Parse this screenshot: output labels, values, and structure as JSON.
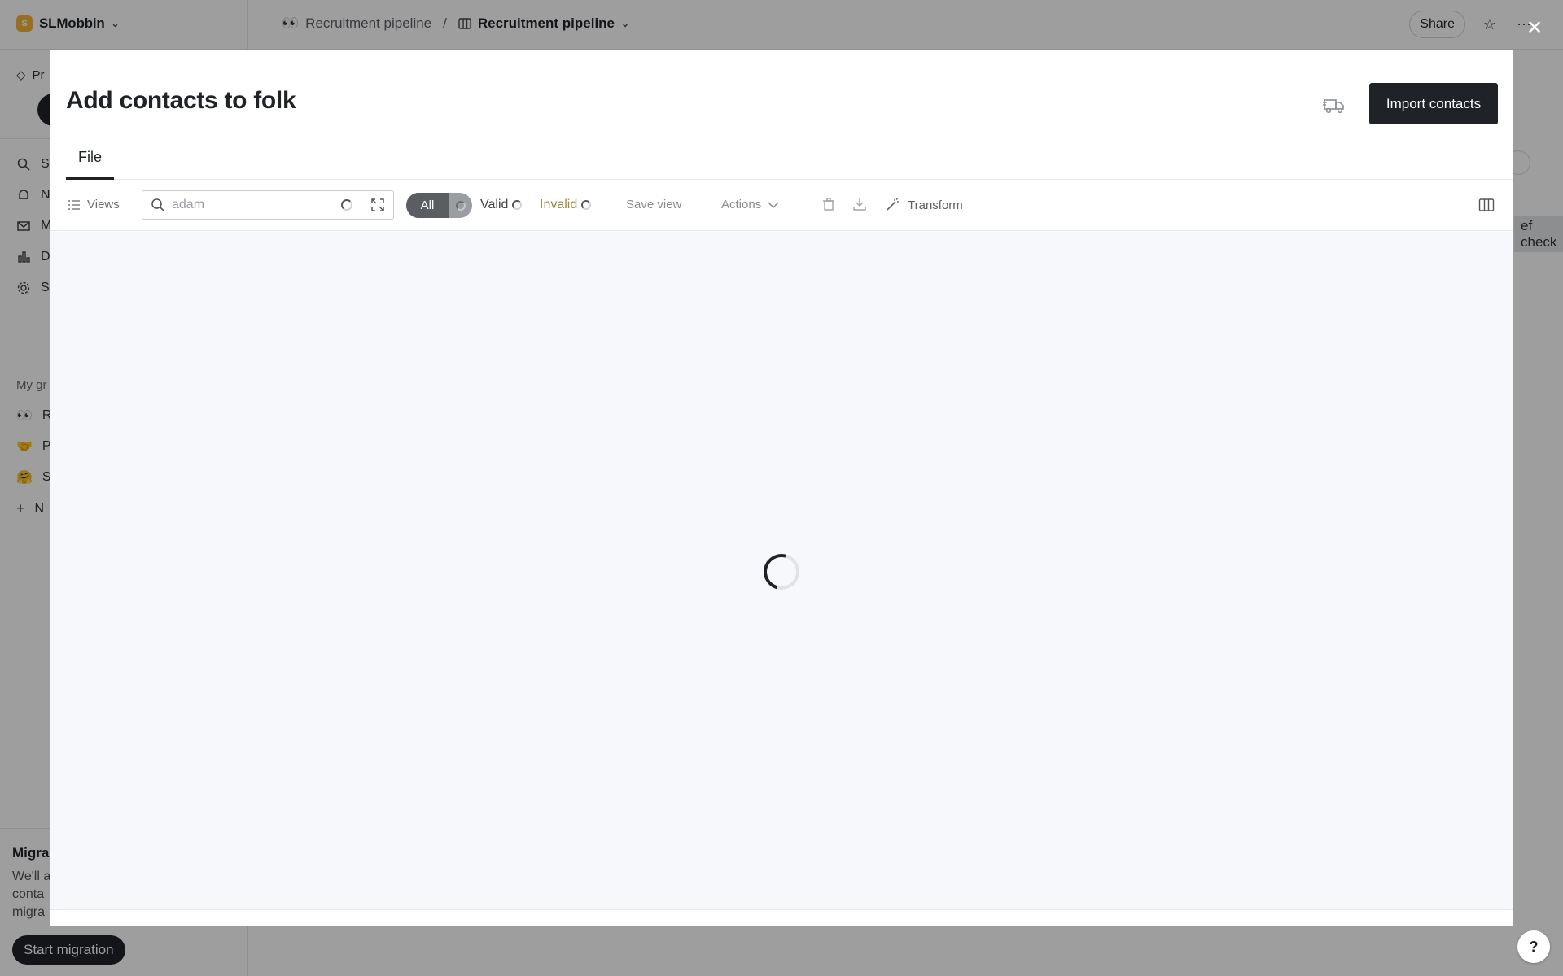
{
  "workspace": {
    "initial": "S",
    "name": "SLMobbin"
  },
  "breadcrumb": {
    "group": "Recruitment pipeline",
    "separator": "/",
    "view": "Recruitment pipeline"
  },
  "header": {
    "share_label": "Share"
  },
  "sidebar": {
    "pro_label": "Pr",
    "items": [
      {
        "label": "S",
        "icon": "search-icon"
      },
      {
        "label": "N",
        "icon": "bell-icon"
      },
      {
        "label": "M",
        "icon": "mail-icon"
      },
      {
        "label": "D",
        "icon": "chart-icon"
      },
      {
        "label": "S",
        "icon": "gear-icon"
      }
    ],
    "section_label": "My gr",
    "groups": [
      {
        "label": "R",
        "icon": "eyes-icon"
      },
      {
        "label": "P",
        "icon": "handshake-icon"
      },
      {
        "label": "S",
        "icon": "face-icon"
      },
      {
        "label": "N",
        "icon": "plus-icon"
      }
    ],
    "migration": {
      "title": "Migra",
      "lines": [
        "We'll a",
        "conta",
        "migra"
      ],
      "button_label": "Start migration"
    }
  },
  "background": {
    "peek_text": "ef check"
  },
  "modal": {
    "title": "Add contacts to folk",
    "import_label": "Import contacts",
    "tabs": [
      "File"
    ],
    "toolbar": {
      "views_label": "Views",
      "search_value": "adam",
      "filter_all": "All",
      "filter_valid": "Valid",
      "filter_invalid": "Invalid",
      "save_view": "Save view",
      "actions": "Actions",
      "transform": "Transform"
    }
  },
  "help_label": "?",
  "colors": {
    "primary_dark": "#1f2328",
    "invalid_text": "#a08a3c",
    "workspace_logo": "#f2b437"
  }
}
